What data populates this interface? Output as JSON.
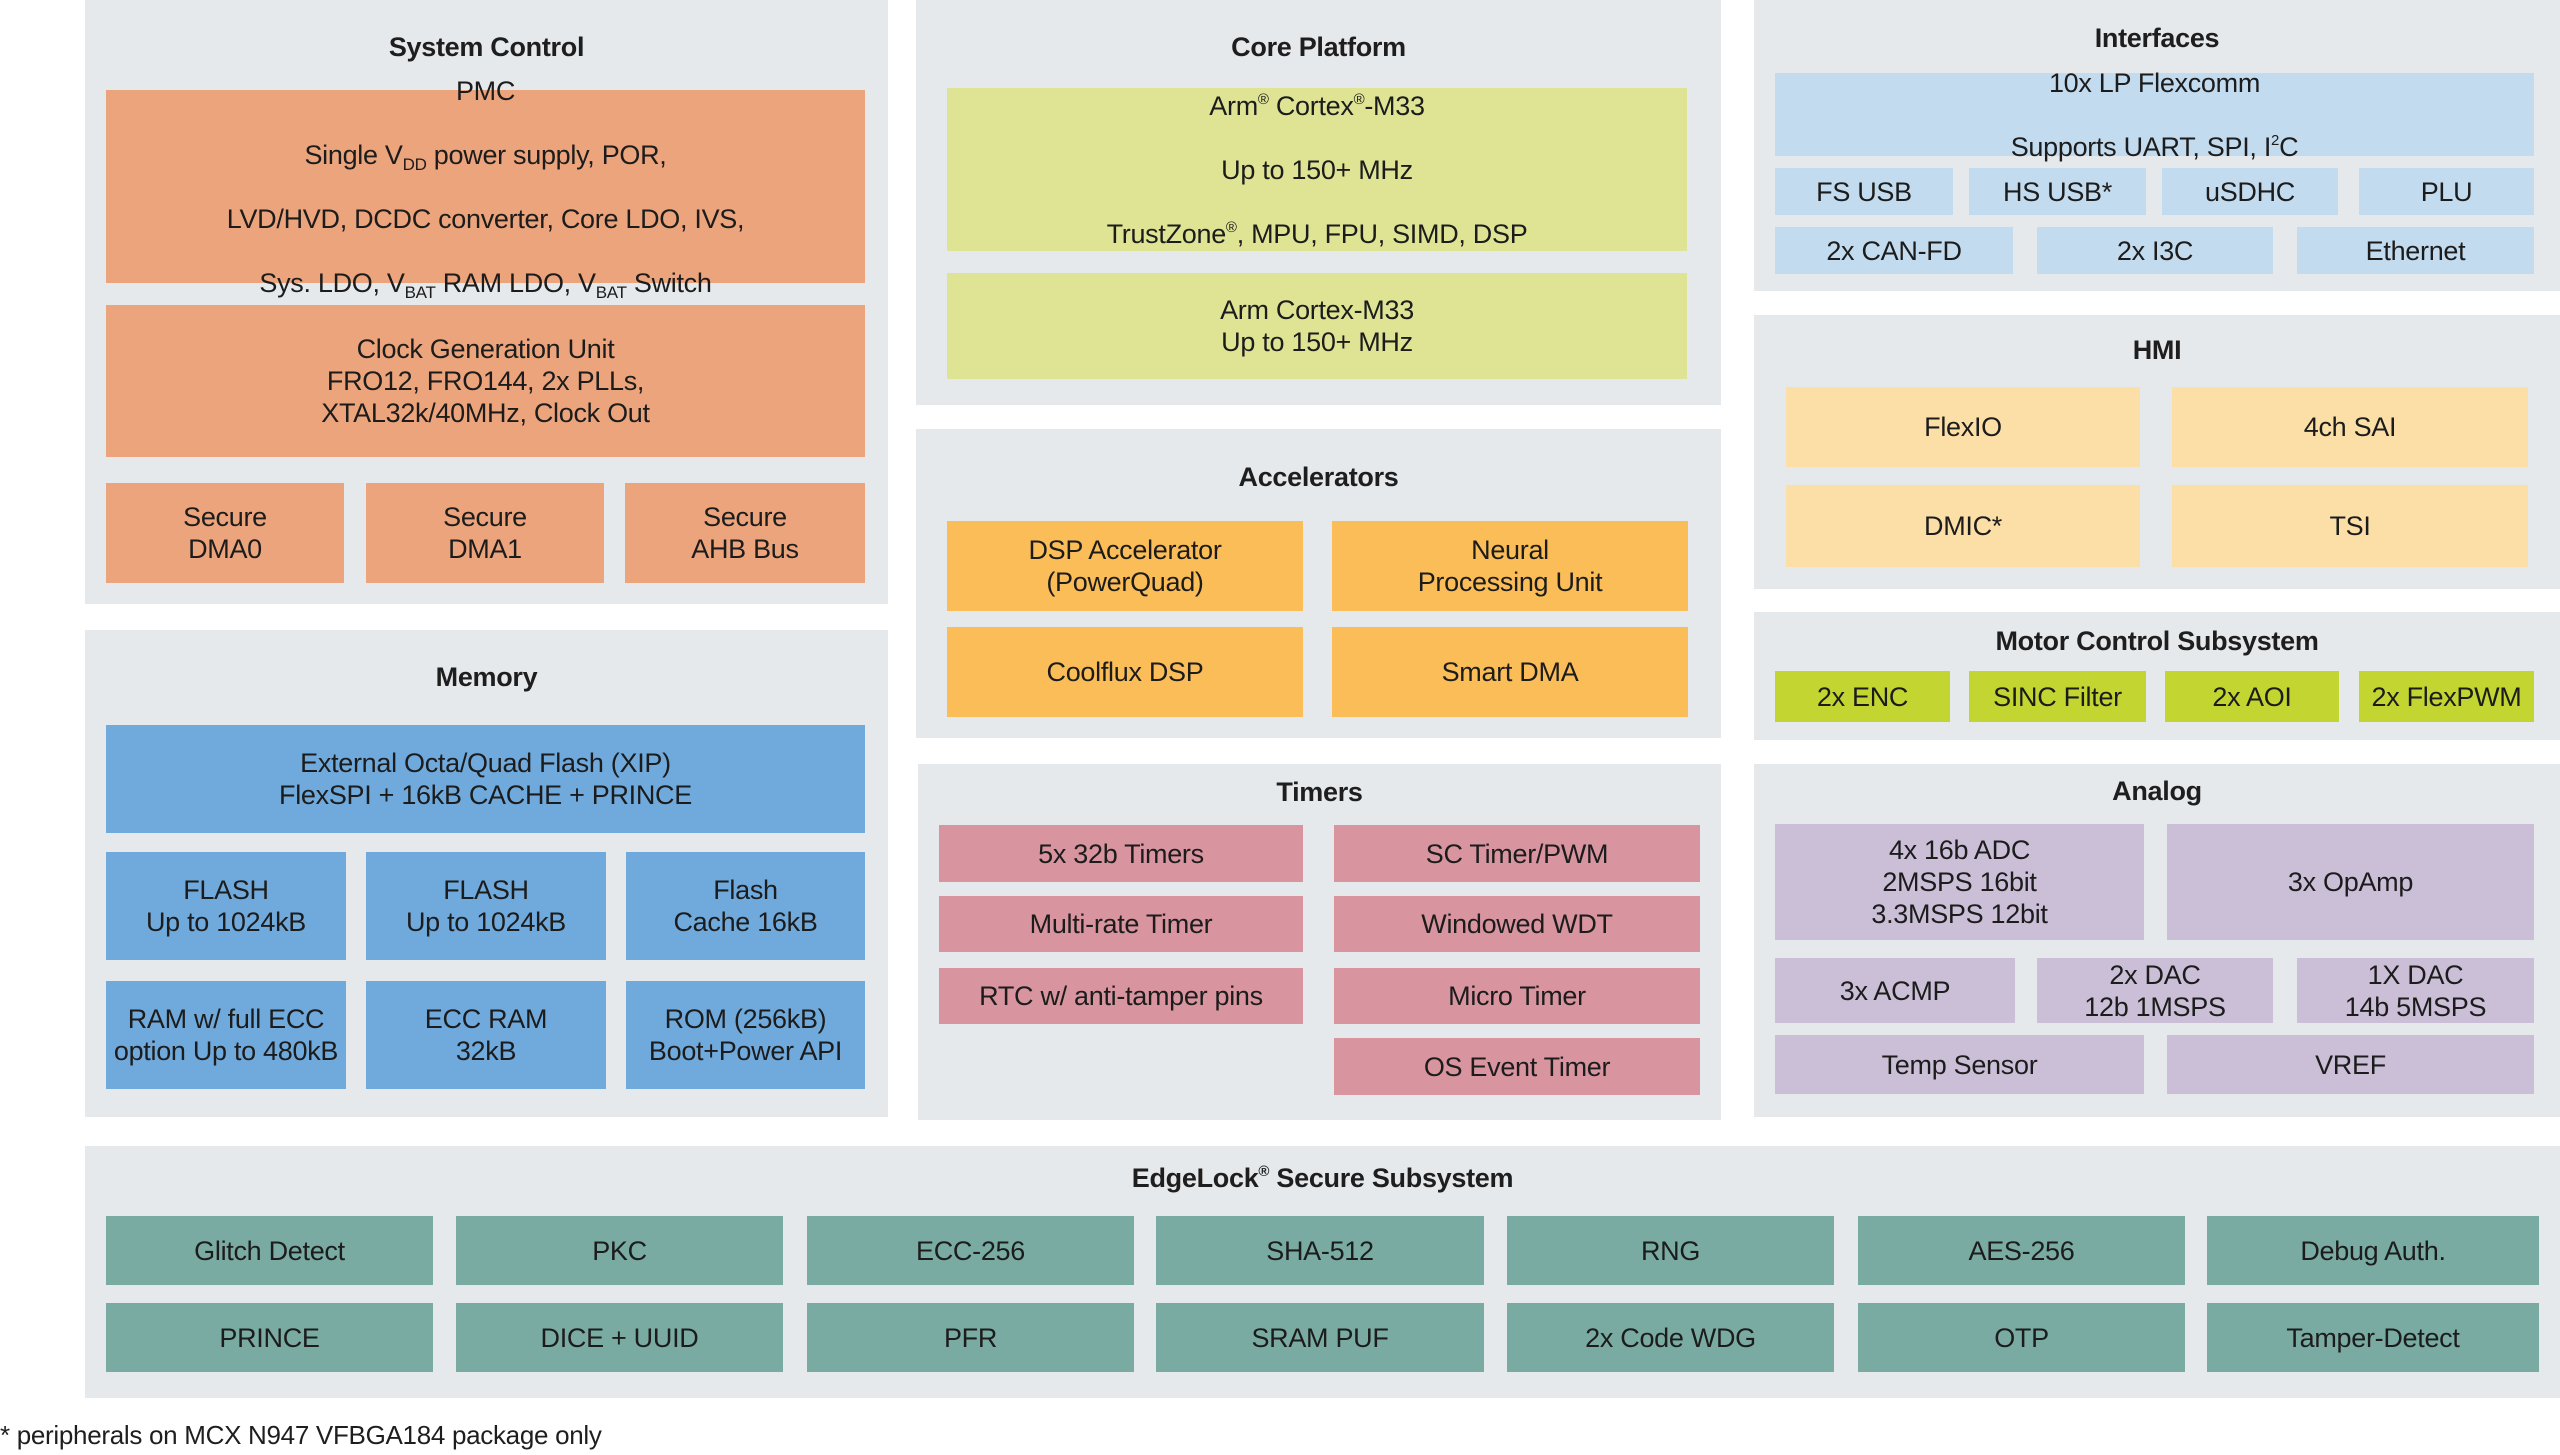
{
  "colors": {
    "panel_bg": "#e6e9ec",
    "system_control": "#eba47c",
    "core_platform": "#dfe494",
    "accelerators": "#fbbd57",
    "timers": "#d8949f",
    "memory": "#70aadc",
    "interfaces": "#c3dbee",
    "hmi": "#fcdfa7",
    "motor_control": "#c2d531",
    "analog": "#cbbfd8",
    "security": "#79aba2"
  },
  "system_control": {
    "title": "System Control",
    "pmc": {
      "line1": "PMC",
      "line2_a": "Single V",
      "line2_sub": "DD",
      "line2_b": " power supply, POR,",
      "line3": "LVD/HVD, DCDC converter, Core LDO, IVS,",
      "line4_a": "Sys. LDO, V",
      "line4_sub1": "BAT",
      "line4_b": " RAM LDO, V",
      "line4_sub2": "BAT",
      "line4_c": " Switch"
    },
    "clock": "Clock Generation Unit\nFRO12, FRO144, 2x PLLs,\nXTAL32k/40MHz, Clock Out",
    "row": [
      "Secure\nDMA0",
      "Secure\nDMA1",
      "Secure\nAHB Bus"
    ]
  },
  "memory": {
    "title": "Memory",
    "external": "External Octa/Quad Flash (XIP)\nFlexSPI + 16kB CACHE + PRINCE",
    "row1": [
      "FLASH\nUp to 1024kB",
      "FLASH\nUp to 1024kB",
      "Flash\nCache 16kB"
    ],
    "row2": [
      "RAM w/ full ECC\noption Up to 480kB",
      "ECC RAM\n32kB",
      "ROM (256kB)\nBoot+Power API"
    ]
  },
  "core_platform": {
    "title": "Core Platform",
    "core1": {
      "line1_a": "Arm",
      "line1_sup1": "®",
      "line1_b": " Cortex",
      "line1_sup2": "®",
      "line1_c": "-M33",
      "line2": "Up to 150+  MHz",
      "line3_a": "TrustZone",
      "line3_sup": "®",
      "line3_b": ", MPU, FPU, SIMD, DSP"
    },
    "core2": "Arm Cortex-M33\nUp to 150+  MHz"
  },
  "accelerators": {
    "title": "Accelerators",
    "items": [
      "DSP Accelerator\n(PowerQuad)",
      "Neural\nProcessing Unit",
      "Coolflux DSP",
      "Smart DMA"
    ]
  },
  "timers": {
    "title": "Timers",
    "left": [
      "5x 32b Timers",
      "Multi-rate Timer",
      "RTC w/ anti-tamper pins"
    ],
    "right": [
      "SC Timer/PWM",
      "Windowed WDT",
      "Micro Timer",
      "OS Event Timer"
    ]
  },
  "interfaces": {
    "title": "Interfaces",
    "flexcomm_line1": "10x LP Flexcomm",
    "flexcomm_line2_a": "Supports UART, SPI, I",
    "flexcomm_line2_sup": "2",
    "flexcomm_line2_b": "C",
    "row1": [
      "FS USB",
      "HS USB*",
      "uSDHC",
      "PLU"
    ],
    "row2": [
      "2x CAN-FD",
      "2x I3C",
      "Ethernet"
    ]
  },
  "hmi": {
    "title": "HMI",
    "items": [
      "FlexIO",
      "4ch SAI",
      "DMIC*",
      "TSI"
    ]
  },
  "motor_control": {
    "title": "Motor Control Subsystem",
    "items": [
      "2x ENC",
      "SINC Filter",
      "2x AOI",
      "2x FlexPWM"
    ]
  },
  "analog": {
    "title": "Analog",
    "adc": "4x 16b ADC\n2MSPS 16bit\n3.3MSPS 12bit",
    "opamp": "3x OpAmp",
    "row2": [
      "3x ACMP",
      "2x DAC\n12b 1MSPS",
      "1X DAC\n14b 5MSPS"
    ],
    "row3": [
      "Temp Sensor",
      "VREF"
    ]
  },
  "edgelock": {
    "title_a": "EdgeLock",
    "title_sup": "®",
    "title_b": " Secure Subsystem",
    "row1": [
      "Glitch Detect",
      "PKC",
      "ECC-256",
      "SHA-512",
      "RNG",
      "AES-256",
      "Debug Auth."
    ],
    "row2": [
      "PRINCE",
      "DICE + UUID",
      "PFR",
      "SRAM PUF",
      "2x Code WDG",
      "OTP",
      "Tamper-Detect"
    ]
  },
  "footnote": "* peripherals on MCX N947 VFBGA184 package only"
}
